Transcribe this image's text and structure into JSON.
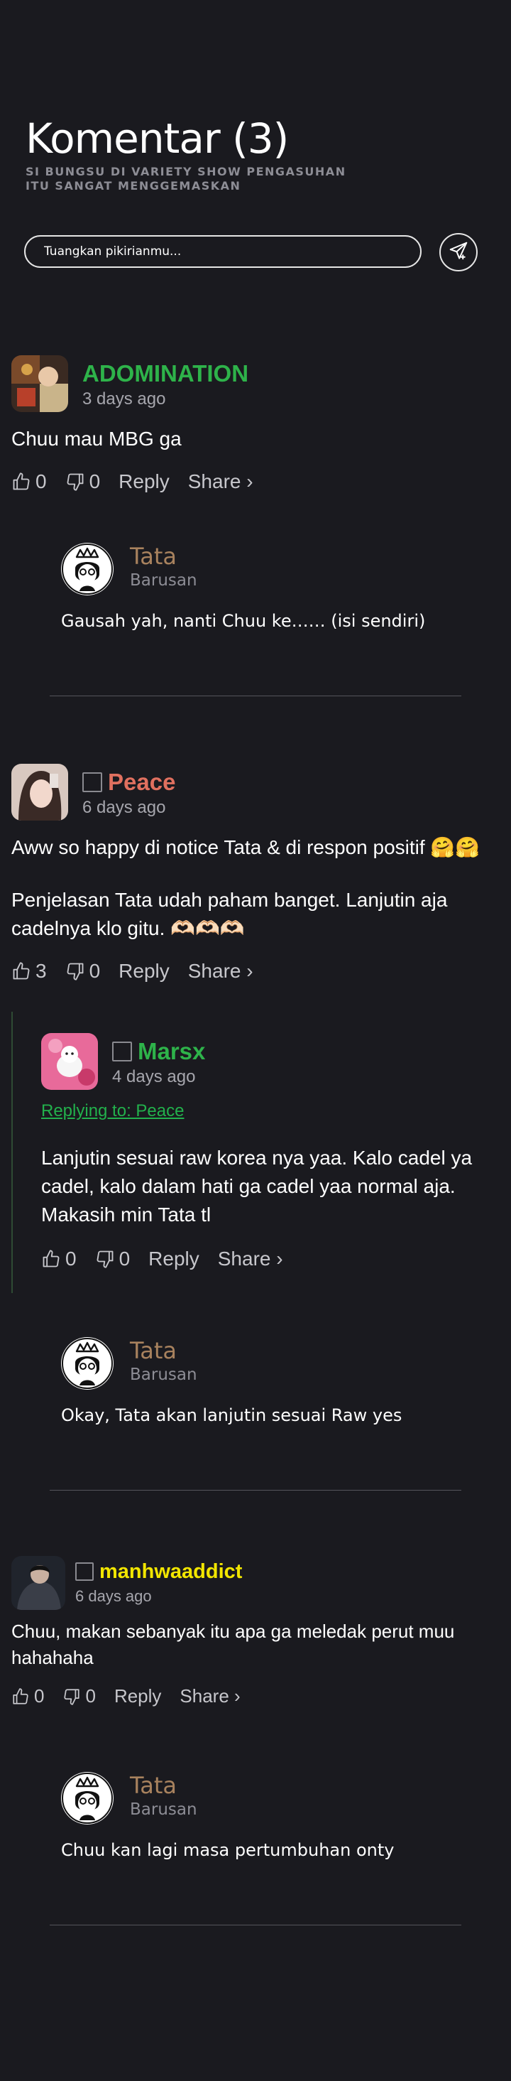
{
  "header": {
    "title": "Komentar (3)",
    "subtitle": "SI BUNGSU DI VARIETY SHOW PENGASUHAN ITU SANGAT MENGGEMASKAN"
  },
  "composer": {
    "placeholder": "Tuangkan pikirianmu...",
    "send_icon": "send-icon"
  },
  "action_labels": {
    "reply": "Reply",
    "share": "Share ›"
  },
  "comments": [
    {
      "name": "ADOMINATION",
      "name_color": "#2eb34a",
      "time": "3 days ago",
      "text": "Chuu mau MBG ga",
      "likes": "0",
      "dislikes": "0",
      "admin_reply": {
        "name": "Tata",
        "time": "Barusan",
        "text": "Gausah yah, nanti Chuu ke…… (isi sendiri)"
      }
    },
    {
      "name": "Peace",
      "name_color": "#e0705f",
      "time": "6 days ago",
      "text": "Aww so happy di notice Tata & di respon positif 🤗🤗",
      "text2": "Penjelasan Tata udah paham banget. Lanjutin aja cadelnya klo gitu. 🫶🏻🫶🏻🫶🏻",
      "likes": "3",
      "dislikes": "0",
      "reply": {
        "name": "Marsx",
        "name_color": "#2eb34a",
        "time": "4 days ago",
        "replying_to": "Replying to: Peace",
        "text": "Lanjutin sesuai raw korea nya yaa. Kalo cadel ya cadel, kalo dalam hati ga cadel yaa normal aja. Makasih min Tata tl",
        "likes": "0",
        "dislikes": "0"
      },
      "admin_reply": {
        "name": "Tata",
        "time": "Barusan",
        "text": "Okay, Tata akan lanjutin sesuai Raw yes"
      }
    },
    {
      "name": "manhwaaddict",
      "name_color": "#f2e600",
      "time": "6 days ago",
      "text": "Chuu, makan sebanyak itu apa ga meledak perut muu hahahaha",
      "likes": "0",
      "dislikes": "0",
      "admin_reply": {
        "name": "Tata",
        "time": "Barusan",
        "text": "Chuu kan lagi masa pertumbuhan onty"
      }
    }
  ]
}
